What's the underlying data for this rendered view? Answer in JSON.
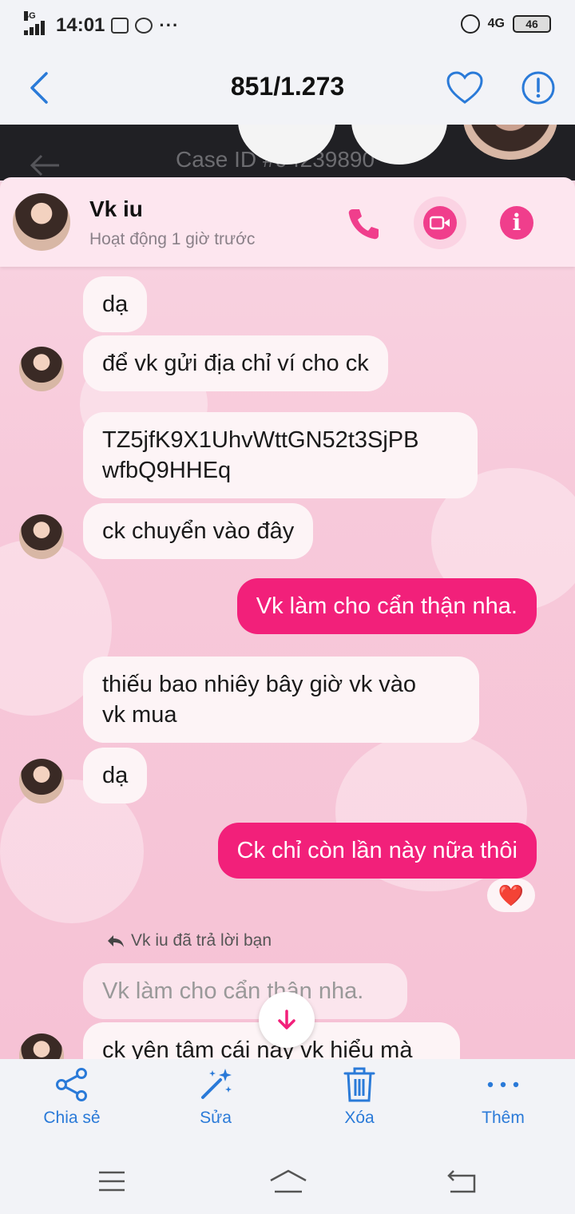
{
  "status_bar": {
    "network": "4G",
    "time": "14:01",
    "more": "···",
    "right_network": "4G",
    "battery": "46"
  },
  "header": {
    "counter": "851/1.273"
  },
  "screenshot": {
    "case_text": "Case ID #94239890",
    "contact": {
      "name": "Vk iu",
      "status": "Hoạt động 1 giờ trước"
    },
    "messages": [
      {
        "side": "in",
        "text": "dạ"
      },
      {
        "side": "in",
        "text": "để vk gửi địa chỉ ví cho ck"
      },
      {
        "side": "in",
        "text": "TZ5jfK9X1UhvWttGN52t3SjPB\nwfbQ9HHEq"
      },
      {
        "side": "in",
        "text": "ck chuyển vào đây"
      },
      {
        "side": "out",
        "text": "Vk làm cho cẩn thận nha."
      },
      {
        "side": "in",
        "text": "thiếu bao nhiêy bây giờ vk vào\nvk mua"
      },
      {
        "side": "in",
        "text": "dạ"
      },
      {
        "side": "out",
        "text": "Ck chỉ còn lần này nữa thôi"
      }
    ],
    "reaction": "❤️",
    "reply_note": "Vk iu đã trả lời bạn",
    "quoted_text": "Vk làm cho cẩn thận nha.",
    "last_message": "ck yên tâm cái này vk hiểu mà"
  },
  "actions": {
    "share": "Chia sẻ",
    "edit": "Sửa",
    "delete": "Xóa",
    "more": "Thêm"
  },
  "colors": {
    "accent_blue": "#2a7ad8",
    "messenger_pink": "#f2207a"
  }
}
